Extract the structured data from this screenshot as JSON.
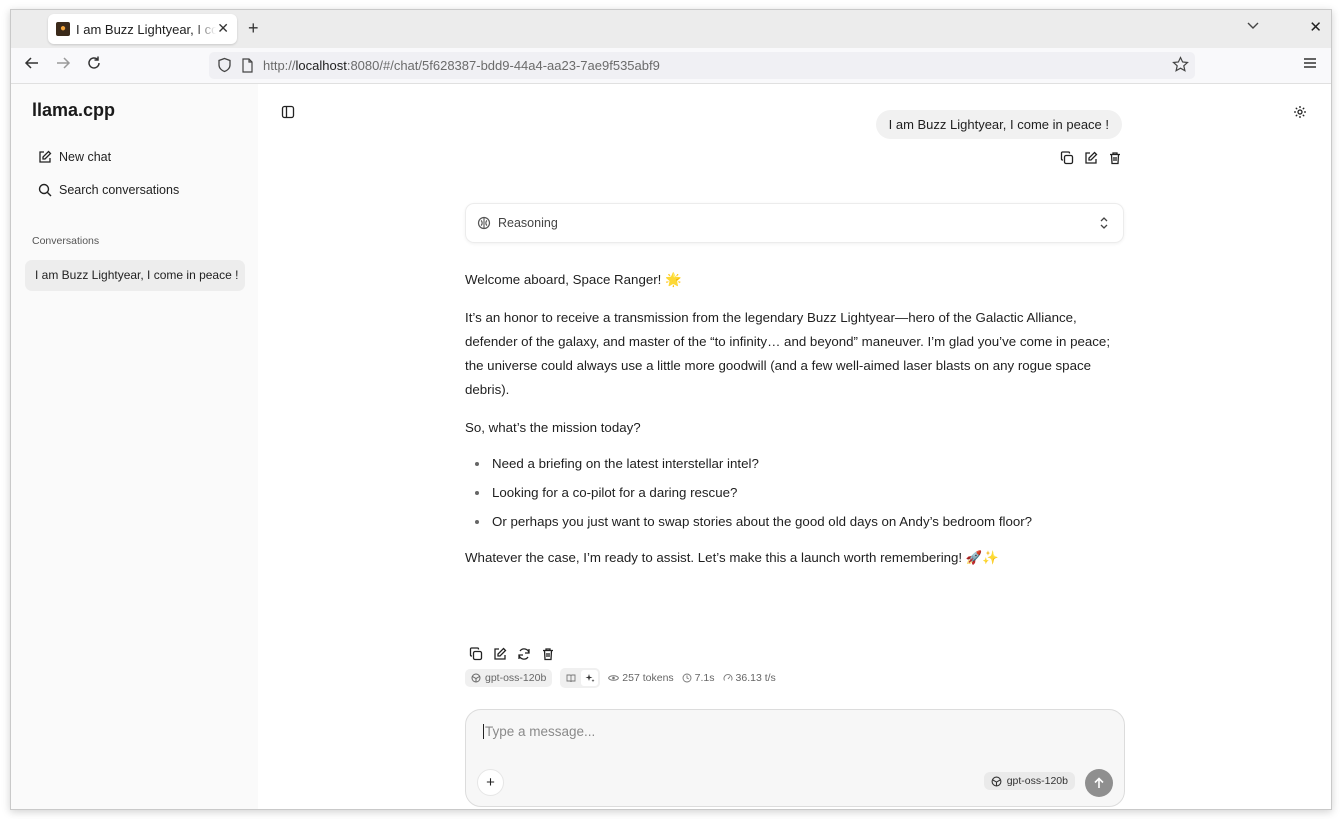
{
  "browser": {
    "tab_title": "I am Buzz Lightyear, I come in peace !",
    "favicon_letter": "🦙",
    "url_prefix": "http://",
    "url_host": "localhost",
    "url_rest": ":8080/#/chat/5f628387-bdd9-44a4-aa23-7ae9f535abf9"
  },
  "sidebar": {
    "app_title": "llama.cpp",
    "new_chat": "New chat",
    "search": "Search conversations",
    "section": "Conversations",
    "conversations": [
      "I am Buzz Lightyear, I come in peace !"
    ]
  },
  "chat": {
    "user_message": "I am Buzz Lightyear, I come in peace !",
    "reasoning_label": "Reasoning",
    "assistant": {
      "p1": "Welcome aboard, Space Ranger! 🌟",
      "p2": "It’s an honor to receive a transmission from the legendary Buzz Lightyear—hero of the Galactic Alliance, defender of the galaxy, and master of the “to infinity… and beyond” maneuver. I’m glad you’ve come in peace; the universe could always use a little more goodwill (and a few well-aimed laser blasts on any rogue space debris).",
      "p3": "So, what’s the mission today?",
      "bullets": [
        "Need a briefing on the latest interstellar intel?",
        "Looking for a co-pilot for a daring rescue?",
        "Or perhaps you just want to swap stories about the good old days on Andy’s bedroom floor?"
      ],
      "p4": "Whatever the case, I’m ready to assist. Let’s make this a launch worth remembering! 🚀✨"
    },
    "stats": {
      "model": "gpt-oss-120b",
      "tokens": "257 tokens",
      "time": "7.1s",
      "speed": "36.13 t/s"
    }
  },
  "composer": {
    "placeholder": "Type a message...",
    "model": "gpt-oss-120b"
  }
}
